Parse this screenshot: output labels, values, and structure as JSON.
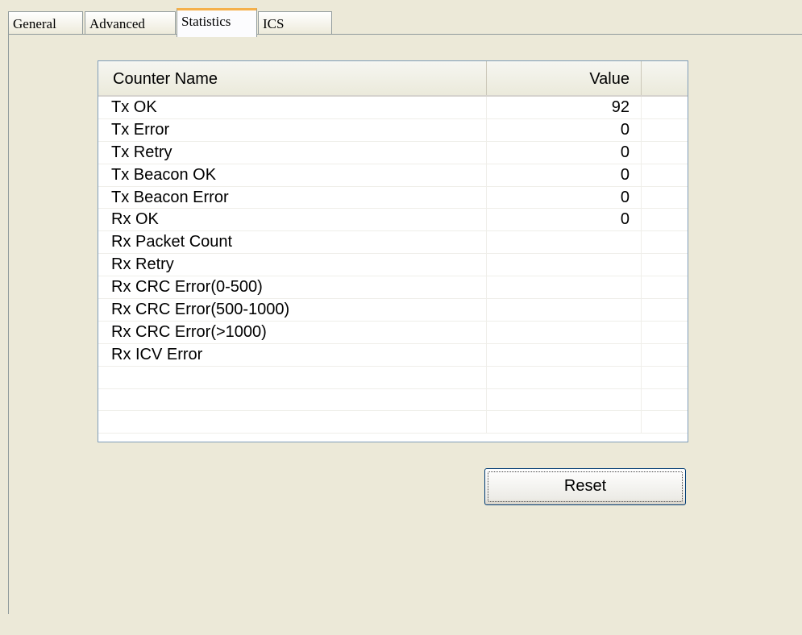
{
  "tabs": [
    {
      "label": "General",
      "active": false
    },
    {
      "label": "Advanced",
      "active": false
    },
    {
      "label": "Statistics",
      "active": true
    },
    {
      "label": "ICS",
      "active": false
    }
  ],
  "table": {
    "columns": {
      "name": "Counter Name",
      "value": "Value"
    },
    "rows": [
      {
        "name": "Tx OK",
        "value": "92"
      },
      {
        "name": "Tx Error",
        "value": "0"
      },
      {
        "name": "Tx Retry",
        "value": "0"
      },
      {
        "name": "Tx Beacon OK",
        "value": "0"
      },
      {
        "name": "Tx Beacon Error",
        "value": "0"
      },
      {
        "name": "Rx OK",
        "value": "0"
      },
      {
        "name": "Rx Packet Count",
        "value": ""
      },
      {
        "name": "Rx Retry",
        "value": ""
      },
      {
        "name": "Rx CRC Error(0-500)",
        "value": ""
      },
      {
        "name": "Rx CRC Error(500-1000)",
        "value": ""
      },
      {
        "name": "Rx CRC Error(>1000)",
        "value": ""
      },
      {
        "name": "Rx ICV Error",
        "value": ""
      },
      {
        "name": "",
        "value": ""
      },
      {
        "name": "",
        "value": ""
      },
      {
        "name": "",
        "value": ""
      }
    ]
  },
  "buttons": {
    "reset_label": "Reset"
  },
  "colors": {
    "active_tab_accent": "#f5b04a",
    "background": "#ece9d8",
    "list_border": "#7f9db9"
  }
}
